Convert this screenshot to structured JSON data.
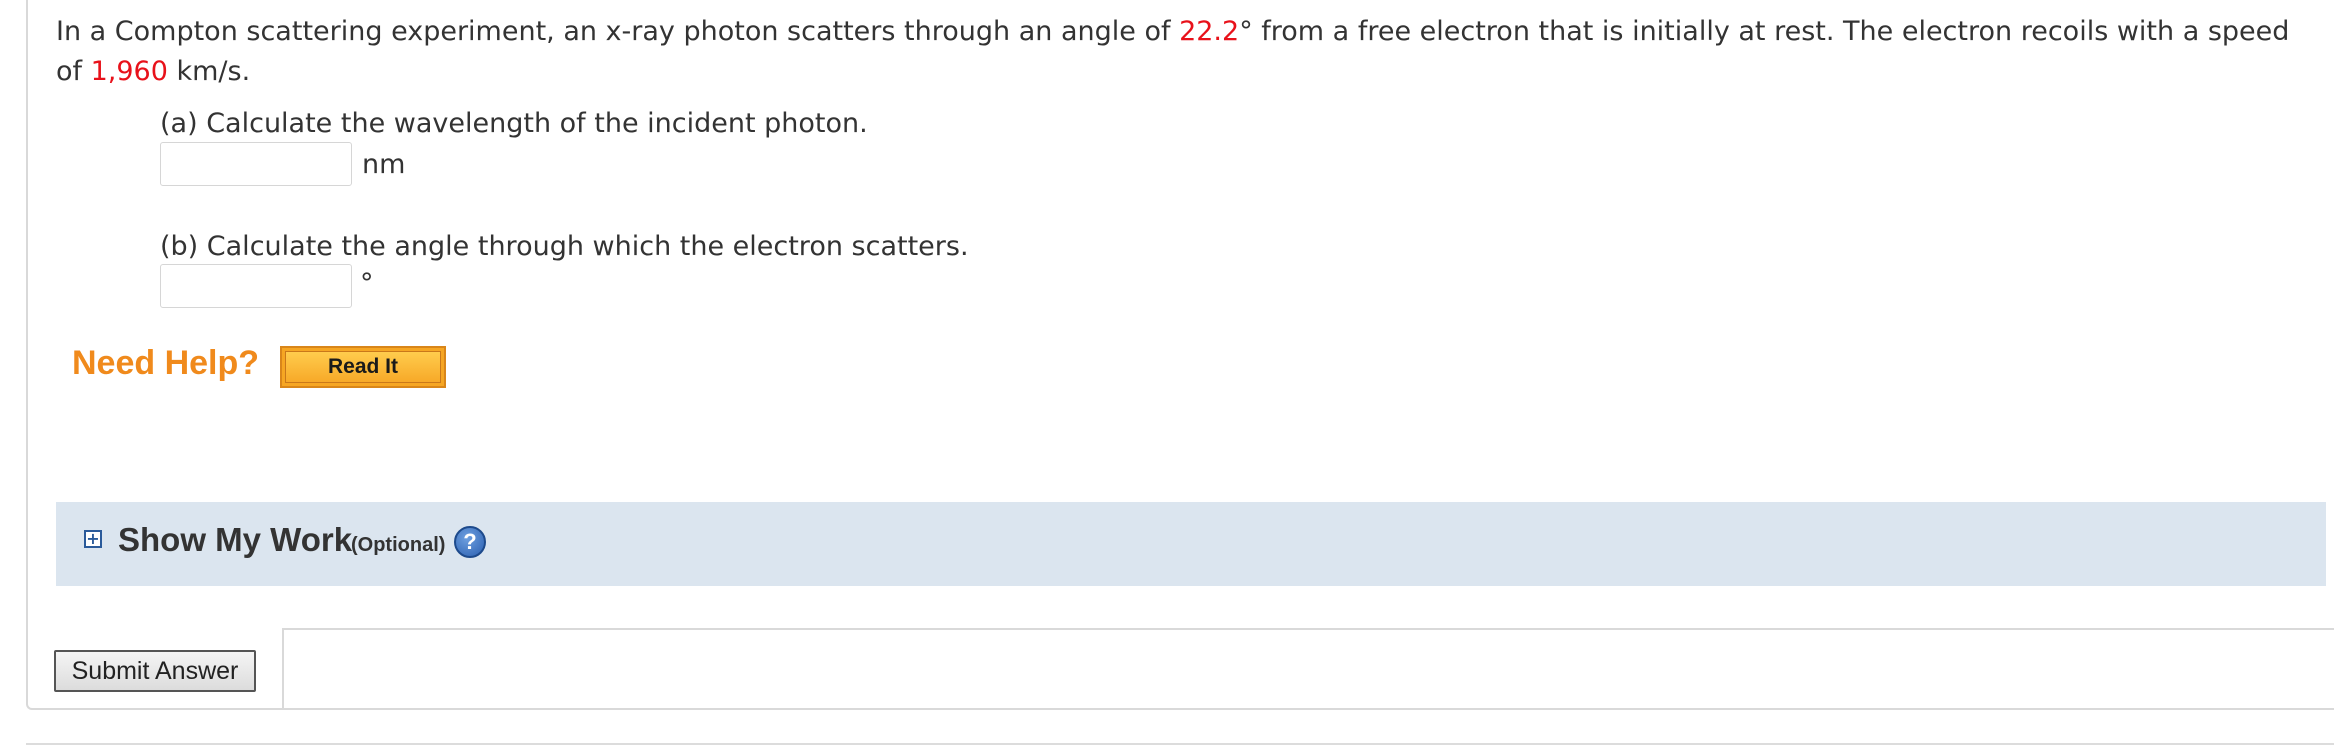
{
  "question": {
    "text_1": "In a Compton scattering experiment, an x-ray photon scatters through an angle of ",
    "angle_value": "22.2",
    "text_2": "° from a free electron that is initially at rest. The electron recoils with a speed of ",
    "speed_value": "1,960",
    "text_3": " km/s."
  },
  "parts": [
    {
      "label": "(a) Calculate the wavelength of the incident photon.",
      "unit": "nm",
      "value": ""
    },
    {
      "label": "(b) Calculate the angle through which the electron scatters.",
      "unit": "°",
      "value": ""
    }
  ],
  "help": {
    "need_help_label": "Need Help?",
    "read_it_label": "Read It"
  },
  "show_my_work": {
    "expand_icon": "+",
    "title": "Show My Work",
    "optional_label": "(Optional)",
    "help_icon": "?"
  },
  "submit": {
    "label": "Submit Answer"
  },
  "colors": {
    "given_value": "#e8111a",
    "need_help": "#f08a1c",
    "read_it_bg": "#f6a623",
    "panel_bg": "#dbe5ef"
  }
}
